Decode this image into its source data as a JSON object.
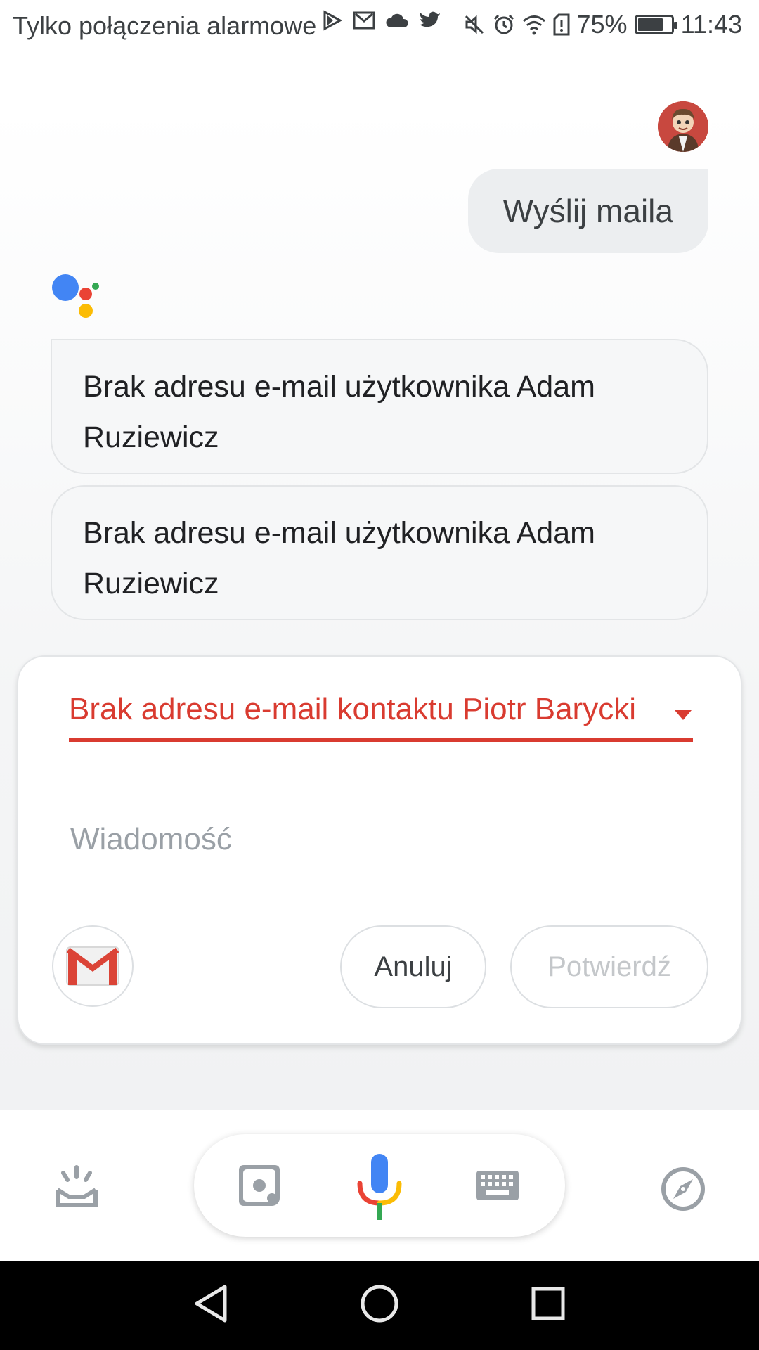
{
  "status_bar": {
    "carrier": "Tylko połączenia alarmowe",
    "battery": "75%",
    "battery_level": 0.75,
    "time": "11:43"
  },
  "conversation": {
    "user_message": "Wyślij maila",
    "assistant_messages": [
      "Brak adresu e-mail użytkownika Adam Ruziewicz",
      "Brak adresu e-mail użytkownika Adam Ruziewicz"
    ]
  },
  "email_card": {
    "recipient_error": "Brak adresu e-mail kontaktu Piotr Barycki",
    "message_placeholder": "Wiadomość",
    "cancel_label": "Anuluj",
    "confirm_label": "Potwierdź"
  },
  "colors": {
    "error_red": "#d93b30",
    "google_blue": "#4285f4",
    "google_red": "#ea4335",
    "google_yellow": "#fbbc05",
    "google_green": "#34a853"
  },
  "icons": [
    "updates-icon",
    "lens-icon",
    "mic-icon",
    "keyboard-icon",
    "explore-icon",
    "back-icon",
    "home-icon",
    "recents-icon"
  ]
}
